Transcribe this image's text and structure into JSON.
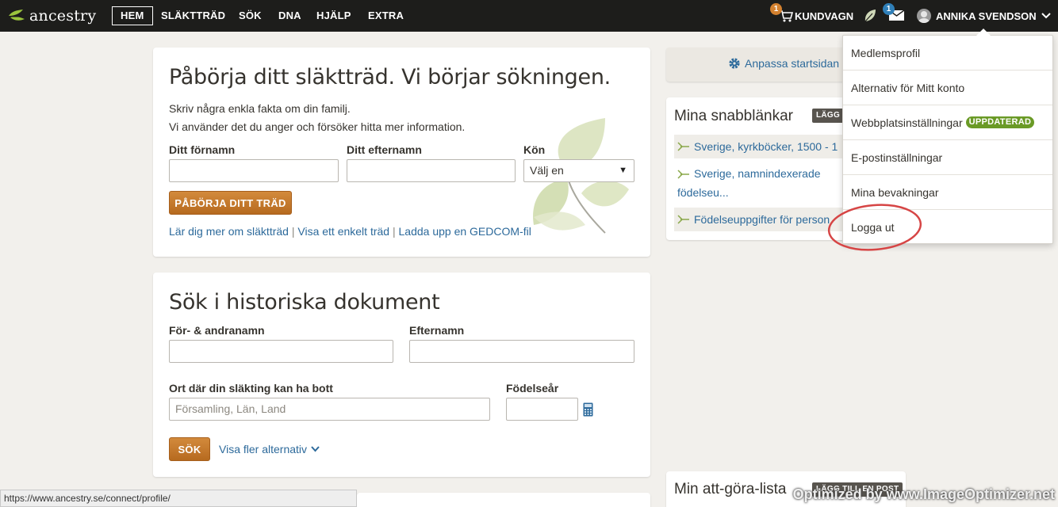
{
  "nav": {
    "logo": "ancestry",
    "items": [
      "HEM",
      "SLÄKTTRÄD",
      "SÖK",
      "DNA",
      "HJÄLP",
      "EXTRA"
    ],
    "cart_label": "KUNDVAGN",
    "cart_count": "1",
    "messages_count": "1",
    "user_name": "ANNIKA SVENDSON"
  },
  "tree_card": {
    "title": "Påbörja ditt släktträd. Vi börjar sökningen.",
    "intro_line1": "Skriv några enkla fakta om din familj.",
    "intro_line2": "Vi använder det du anger och försöker hitta mer information.",
    "first_name_label": "Ditt förnamn",
    "first_name_value": "",
    "last_name_label": "Ditt efternamn",
    "last_name_value": "",
    "gender_label": "Kön",
    "gender_selected": "Välj en",
    "start_button": "PÅBÖRJA DITT TRÄD",
    "links": [
      "Lär dig mer om släktträd",
      "Visa ett enkelt träd",
      "Ladda upp en GEDCOM-fil"
    ],
    "separator": "|"
  },
  "search_card": {
    "title": "Sök i historiska dokument",
    "given_label": "För- & andranamn",
    "given_value": "",
    "surname_label": "Efternamn",
    "surname_value": "",
    "place_label": "Ort där din släkting kan ha bott",
    "place_placeholder": "Församling, Län, Land",
    "birth_label": "Födelseår",
    "birth_value": "",
    "search_button": "SÖK",
    "more_options": "Visa fler alternativ"
  },
  "sidebar": {
    "customize": "Anpassa startsidan",
    "quicklinks_title": "Mina snabblänkar",
    "quicklinks_tag": "LÄGG T",
    "quicklinks": [
      "Sverige, kyrkböcker, 1500 - 1",
      "Sverige, namnindexerade",
      "födelseu...",
      "Födelseuppgifter för person"
    ],
    "todo_title": "Min att-göra-lista",
    "todo_tag": "LÄGG TILL EN POST"
  },
  "dropdown": {
    "items": [
      "Medlemsprofil",
      "Alternativ för Mitt konto",
      "Webbplatsinställningar",
      "E-postinställningar",
      "Mina bevakningar",
      "Logga ut"
    ],
    "updated_badge": "UPPDATERAD"
  },
  "status_url": "https://www.ancestry.se/connect/profile/",
  "watermark": "Optimized by www.ImageOptimizer.net",
  "colors": {
    "accent": "#c07627",
    "link": "#2d6a9b",
    "nav_bg": "#1d1d1b",
    "highlight_circle": "#d64545",
    "badge_green": "#6a9a26"
  }
}
